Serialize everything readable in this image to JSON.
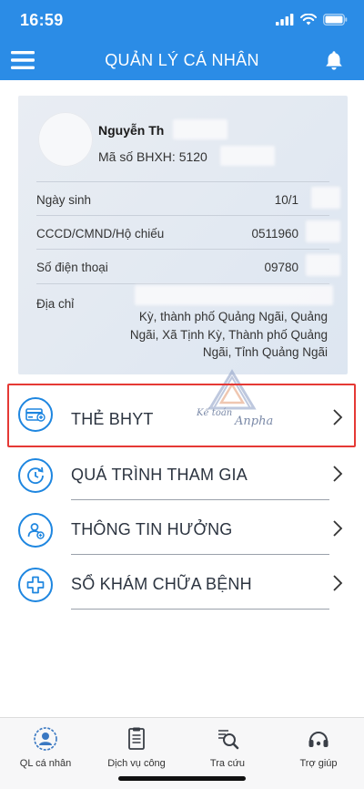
{
  "status_bar": {
    "time": "16:59"
  },
  "header": {
    "title": "QUẢN LÝ CÁ NHÂN"
  },
  "profile": {
    "name": "Nguyễn Th",
    "bhxh_code": "Mã số BHXH: 5120",
    "fields": [
      {
        "label": "Ngày sinh",
        "value": "10/1"
      },
      {
        "label": "CCCD/CMND/Hộ chiếu",
        "value": "0511960"
      },
      {
        "label": "Số điện thoại",
        "value": "09780"
      }
    ],
    "address_label": "Địa chỉ",
    "address_value": "Kỳ, thành phố Quảng Ngãi, Quảng Ngãi, Xã Tịnh Kỳ, Thành phố Quảng Ngãi, Tỉnh Quảng Ngãi"
  },
  "menu": [
    {
      "label": "THẺ BHYT",
      "icon": "health-card-icon"
    },
    {
      "label": "QUÁ TRÌNH THAM GIA",
      "icon": "history-icon"
    },
    {
      "label": "THÔNG TIN HƯỞNG",
      "icon": "beneficiary-icon"
    },
    {
      "label": "SỔ KHÁM CHỮA BỆNH",
      "icon": "medical-cross-icon"
    }
  ],
  "watermark": {
    "line1": "Kế toán",
    "line2": "Anpha"
  },
  "tabs": [
    {
      "label": "QL cá nhân",
      "icon": "person-badge-icon",
      "active": true
    },
    {
      "label": "Dịch vụ công",
      "icon": "document-icon",
      "active": false
    },
    {
      "label": "Tra cứu",
      "icon": "search-icon",
      "active": false
    },
    {
      "label": "Trợ giúp",
      "icon": "headset-icon",
      "active": false
    }
  ],
  "colors": {
    "header": "#2b8ce6",
    "accent": "#1e86e0",
    "highlight": "#e53935"
  }
}
